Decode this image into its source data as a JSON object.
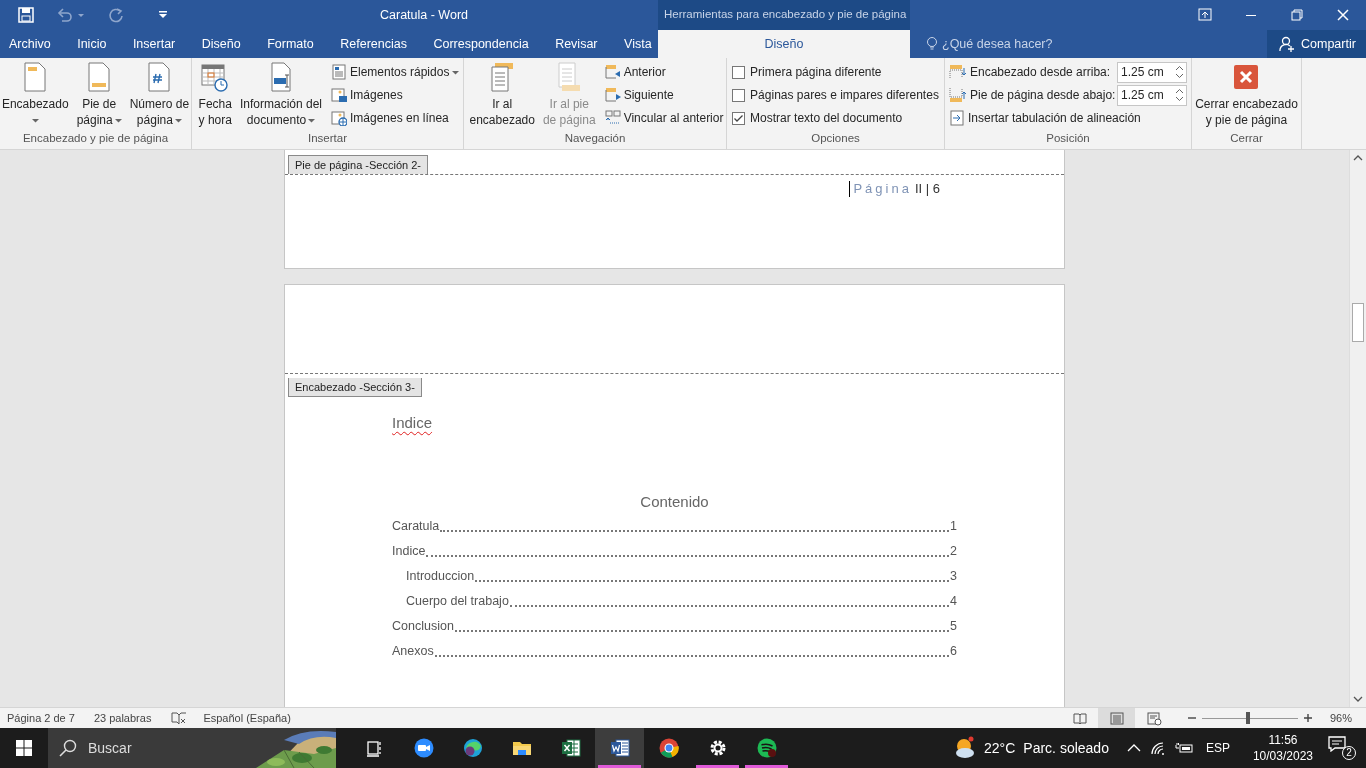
{
  "title_bar": {
    "title": "Caratula - Word",
    "context_title": "Herramientas para encabezado y pie de página"
  },
  "tabs": [
    {
      "label": "Archivo",
      "selected": false,
      "kind": "normal"
    },
    {
      "label": "Inicio",
      "selected": false,
      "kind": "normal"
    },
    {
      "label": "Insertar",
      "selected": false,
      "kind": "normal"
    },
    {
      "label": "Diseño",
      "selected": false,
      "kind": "normal"
    },
    {
      "label": "Formato",
      "selected": false,
      "kind": "normal"
    },
    {
      "label": "Referencias",
      "selected": false,
      "kind": "normal"
    },
    {
      "label": "Correspondencia",
      "selected": false,
      "kind": "normal"
    },
    {
      "label": "Revisar",
      "selected": false,
      "kind": "normal"
    },
    {
      "label": "Vista",
      "selected": false,
      "kind": "normal"
    },
    {
      "label": "Diseño",
      "selected": true,
      "kind": "contextual"
    }
  ],
  "tell_me": {
    "placeholder": "¿Qué desea hacer?"
  },
  "share": "Compartir",
  "ribbon": [
    {
      "label": "Encabezado y pie de página",
      "items": [
        {
          "kind": "large",
          "lines": [
            "Encabezado"
          ],
          "dropdown": true,
          "disabled": false
        },
        {
          "kind": "large",
          "lines": [
            "Pie de",
            "página"
          ],
          "dropdown": true,
          "disabled": false
        },
        {
          "kind": "large",
          "lines": [
            "Número de",
            "página"
          ],
          "dropdown": true,
          "disabled": false
        }
      ]
    },
    {
      "label": "Insertar",
      "items": [
        {
          "kind": "large",
          "lines": [
            "Fecha",
            "y hora"
          ],
          "dropdown": false,
          "disabled": false
        },
        {
          "kind": "large",
          "lines": [
            "Información del",
            "documento"
          ],
          "dropdown": true,
          "disabled": false
        },
        {
          "kind": "small",
          "label": "Elementos rápidos",
          "dropdown": true,
          "disabled": false
        },
        {
          "kind": "small",
          "label": "Imágenes",
          "dropdown": false,
          "disabled": false
        },
        {
          "kind": "small",
          "label": "Imágenes en línea",
          "dropdown": false,
          "disabled": false
        }
      ]
    },
    {
      "label": "Navegación",
      "items": [
        {
          "kind": "large",
          "lines": [
            "Ir al",
            "encabezado"
          ],
          "dropdown": false,
          "disabled": false
        },
        {
          "kind": "large",
          "lines": [
            "Ir al pie",
            "de página"
          ],
          "dropdown": false,
          "disabled": true
        },
        {
          "kind": "small",
          "label": "Anterior",
          "dropdown": false,
          "disabled": false
        },
        {
          "kind": "small",
          "label": "Siguiente",
          "dropdown": false,
          "disabled": false
        },
        {
          "kind": "small",
          "label": "Vincular al anterior",
          "dropdown": false,
          "disabled": false
        }
      ]
    },
    {
      "label": "Opciones",
      "items": [
        {
          "kind": "check",
          "label": "Primera página diferente",
          "checked": false
        },
        {
          "kind": "check",
          "label": "Páginas pares e impares diferentes",
          "checked": false
        },
        {
          "kind": "check",
          "label": "Mostrar texto del documento",
          "checked": true
        }
      ]
    },
    {
      "label": "Posición",
      "items": [
        {
          "kind": "spin",
          "label": "Encabezado desde arriba:",
          "value": "1.25 cm"
        },
        {
          "kind": "spin",
          "label": "Pie de página desde abajo:",
          "value": "1.25 cm"
        },
        {
          "kind": "small",
          "label": "Insertar tabulación de alineación",
          "dropdown": false,
          "disabled": false
        }
      ]
    },
    {
      "label": "Cerrar",
      "items": [
        {
          "kind": "large",
          "lines": [
            "Cerrar encabezado",
            "y pie de página"
          ],
          "dropdown": false,
          "disabled": false
        }
      ]
    }
  ],
  "document": {
    "footer_tag": "Pie de página -Sección 2-",
    "page_label": "Página",
    "page_number": "II | 6",
    "header_tag": "Encabezado -Sección 3-",
    "heading": {
      "text": "Indice",
      "misspelled": true
    },
    "toc_title": "Contenido",
    "toc": [
      {
        "title": "Caratula",
        "page": "1"
      },
      {
        "title": "Indice",
        "page": "2",
        "children": [
          {
            "title": "Introduccion",
            "page": "3"
          },
          {
            "title": "Cuerpo del trabajo",
            "page": "4"
          }
        ]
      },
      {
        "title": "Conclusion",
        "page": "5"
      },
      {
        "title": "Anexos",
        "page": "6"
      }
    ]
  },
  "status_bar": {
    "page": "Página 2 de 7",
    "words": "23 palabras",
    "language": "Español (España)",
    "views": [
      {
        "selected": false
      },
      {
        "selected": true
      },
      {
        "selected": false
      }
    ],
    "zoom": {
      "level": 0.48,
      "reading": "96%"
    }
  },
  "taskbar": {
    "search_placeholder": "Buscar",
    "apps": [
      {
        "running": false,
        "selected": false
      },
      {
        "running": false,
        "selected": false
      },
      {
        "running": false,
        "selected": false
      },
      {
        "running": false,
        "selected": false
      },
      {
        "running": false,
        "selected": false
      },
      {
        "running": true,
        "selected": true
      },
      {
        "running": false,
        "selected": false
      },
      {
        "running": true,
        "selected": false
      },
      {
        "running": true,
        "selected": false
      }
    ],
    "weather": {
      "temperature": "22°C",
      "condition": "Parc. soleado"
    },
    "language": "ESP",
    "time": "11:56",
    "date": "10/03/2023",
    "notifications": "2"
  }
}
